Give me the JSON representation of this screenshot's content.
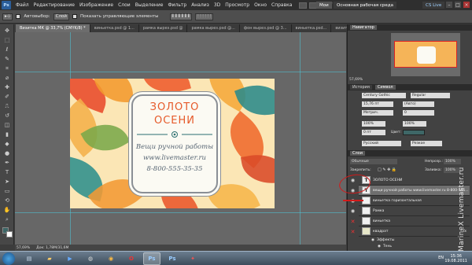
{
  "menubar": {
    "logo": "Ps",
    "items": [
      "Файл",
      "Редактирование",
      "Изображение",
      "Слои",
      "Выделение",
      "Фильтр",
      "Анализ",
      "3D",
      "Просмотр",
      "Окно",
      "Справка"
    ],
    "zoom": "57,7",
    "workspace_small": "Мои",
    "workspace": "Основная рабочая среда",
    "cslive": "CS Live"
  },
  "options": {
    "autoselect_label": "Автовыбор:",
    "autoselect_value": "Слой",
    "show_controls": "Показать управляющие элементы"
  },
  "tabs": [
    "Визитка МК @ 33,7% (CMYK/8) *",
    "виньетка.psd @ 1...",
    "рамка вырез.psd @",
    "рамка вырез.psd @...",
    "фон вырез.psd @ 3...",
    "виньетка.psd...",
    "визитки на вырез.psd..."
  ],
  "card": {
    "title_line1": "ЗОЛОТО",
    "title_line2": "ОСЕНИ",
    "subtitle": "Вещи ручной работы",
    "site": "www.livemaster.ru",
    "phone": "8-800-555-35-35"
  },
  "status": {
    "zoom": "57,69%",
    "doc": "Док: 1,78М/31,6М"
  },
  "navigator": {
    "title": "Навигатор",
    "zoom": "57,69%"
  },
  "character": {
    "tabs": [
      "История",
      "Символ"
    ],
    "font": "Century Gothic",
    "style": "Regular",
    "size": "15,76 пт",
    "leading": "(Авто)",
    "kerning": "Метрич.",
    "tracking": "0",
    "scale_v": "100%",
    "scale_h": "100%",
    "baseline": "0 пт",
    "color_label": "Цвет:",
    "language": "Русский",
    "aa": "Резкое"
  },
  "layers": {
    "title": "Слои",
    "blend": "Обычные",
    "opacity_label": "Непрозр.:",
    "opacity": "100%",
    "lock_label": "Закрепить:",
    "fill_label": "Заливка:",
    "fill": "100%",
    "items": [
      {
        "name": "ЗОЛОТО ОСЕНИ",
        "type": "T"
      },
      {
        "name": "вещи ручной работы www.livemaster.ru 8-800-555...",
        "type": "T"
      },
      {
        "name": "виньетка горизонтальная",
        "type": ""
      },
      {
        "name": "Рамка",
        "type": ""
      },
      {
        "name": "виньетка",
        "type": ""
      },
      {
        "name": "квадрат",
        "type": ""
      },
      {
        "name": "Эффекты",
        "type": ""
      },
      {
        "name": "Тень",
        "type": ""
      }
    ]
  },
  "watermark": "MarineX Livemaster.ru",
  "taskbar": {
    "time": "15:36",
    "date": "19.08.2011",
    "lang": "EN"
  },
  "colors": {
    "accent_title": "#e65a2a",
    "text_slate": "#586674",
    "annotation": "#d21a1a"
  }
}
